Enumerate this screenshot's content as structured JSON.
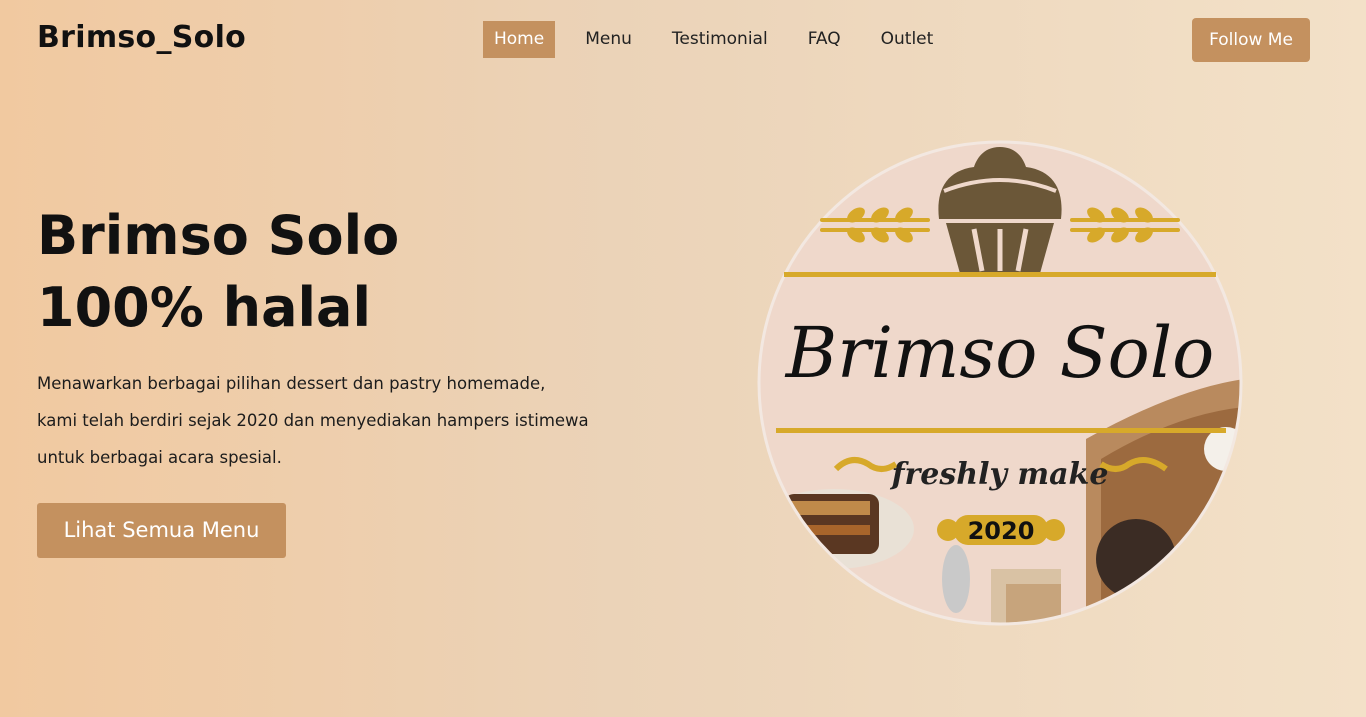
{
  "nav": {
    "brand": "Brimso_Solo",
    "links": [
      "Home",
      "Menu",
      "Testimonial",
      "FAQ",
      "Outlet"
    ],
    "active": "Home",
    "follow_label": "Follow Me"
  },
  "hero": {
    "title_line1": "Brimso Solo",
    "title_line2": "100% halal",
    "description_lines": [
      "Menawarkan berbagai pilihan dessert dan pastry homemade,",
      "kami telah berdiri sejak 2020 dan menyediakan hampers istimewa",
      "untuk berbagai acara spesial."
    ],
    "cta_label": "Lihat Semua Menu"
  },
  "logo": {
    "name": "Brimso Solo",
    "tagline": "freshly make",
    "year": "2020",
    "icon": "cupcake-icon"
  },
  "colors": {
    "accent": "#c4915f",
    "gold": "#d7a92a",
    "cupcake": "#6b5738"
  }
}
